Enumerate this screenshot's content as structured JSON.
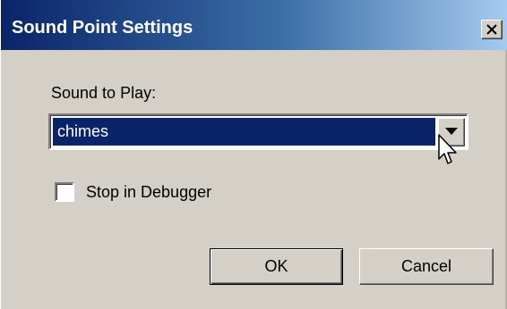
{
  "window": {
    "title": "Sound Point Settings",
    "close_symbol": "✕"
  },
  "sound": {
    "label": "Sound to Play:",
    "selected": "chimes"
  },
  "stop_debugger": {
    "label": "Stop in Debugger",
    "checked": false
  },
  "buttons": {
    "ok": "OK",
    "cancel": "Cancel"
  },
  "colors": {
    "title_start": "#0a246a",
    "title_end": "#a6caf0",
    "dialog_face": "#d4d0c8",
    "selection": "#0a246a"
  },
  "icons": {
    "close": "close-icon",
    "dropdown": "chevron-down-icon",
    "pointer": "mouse-pointer-icon"
  }
}
